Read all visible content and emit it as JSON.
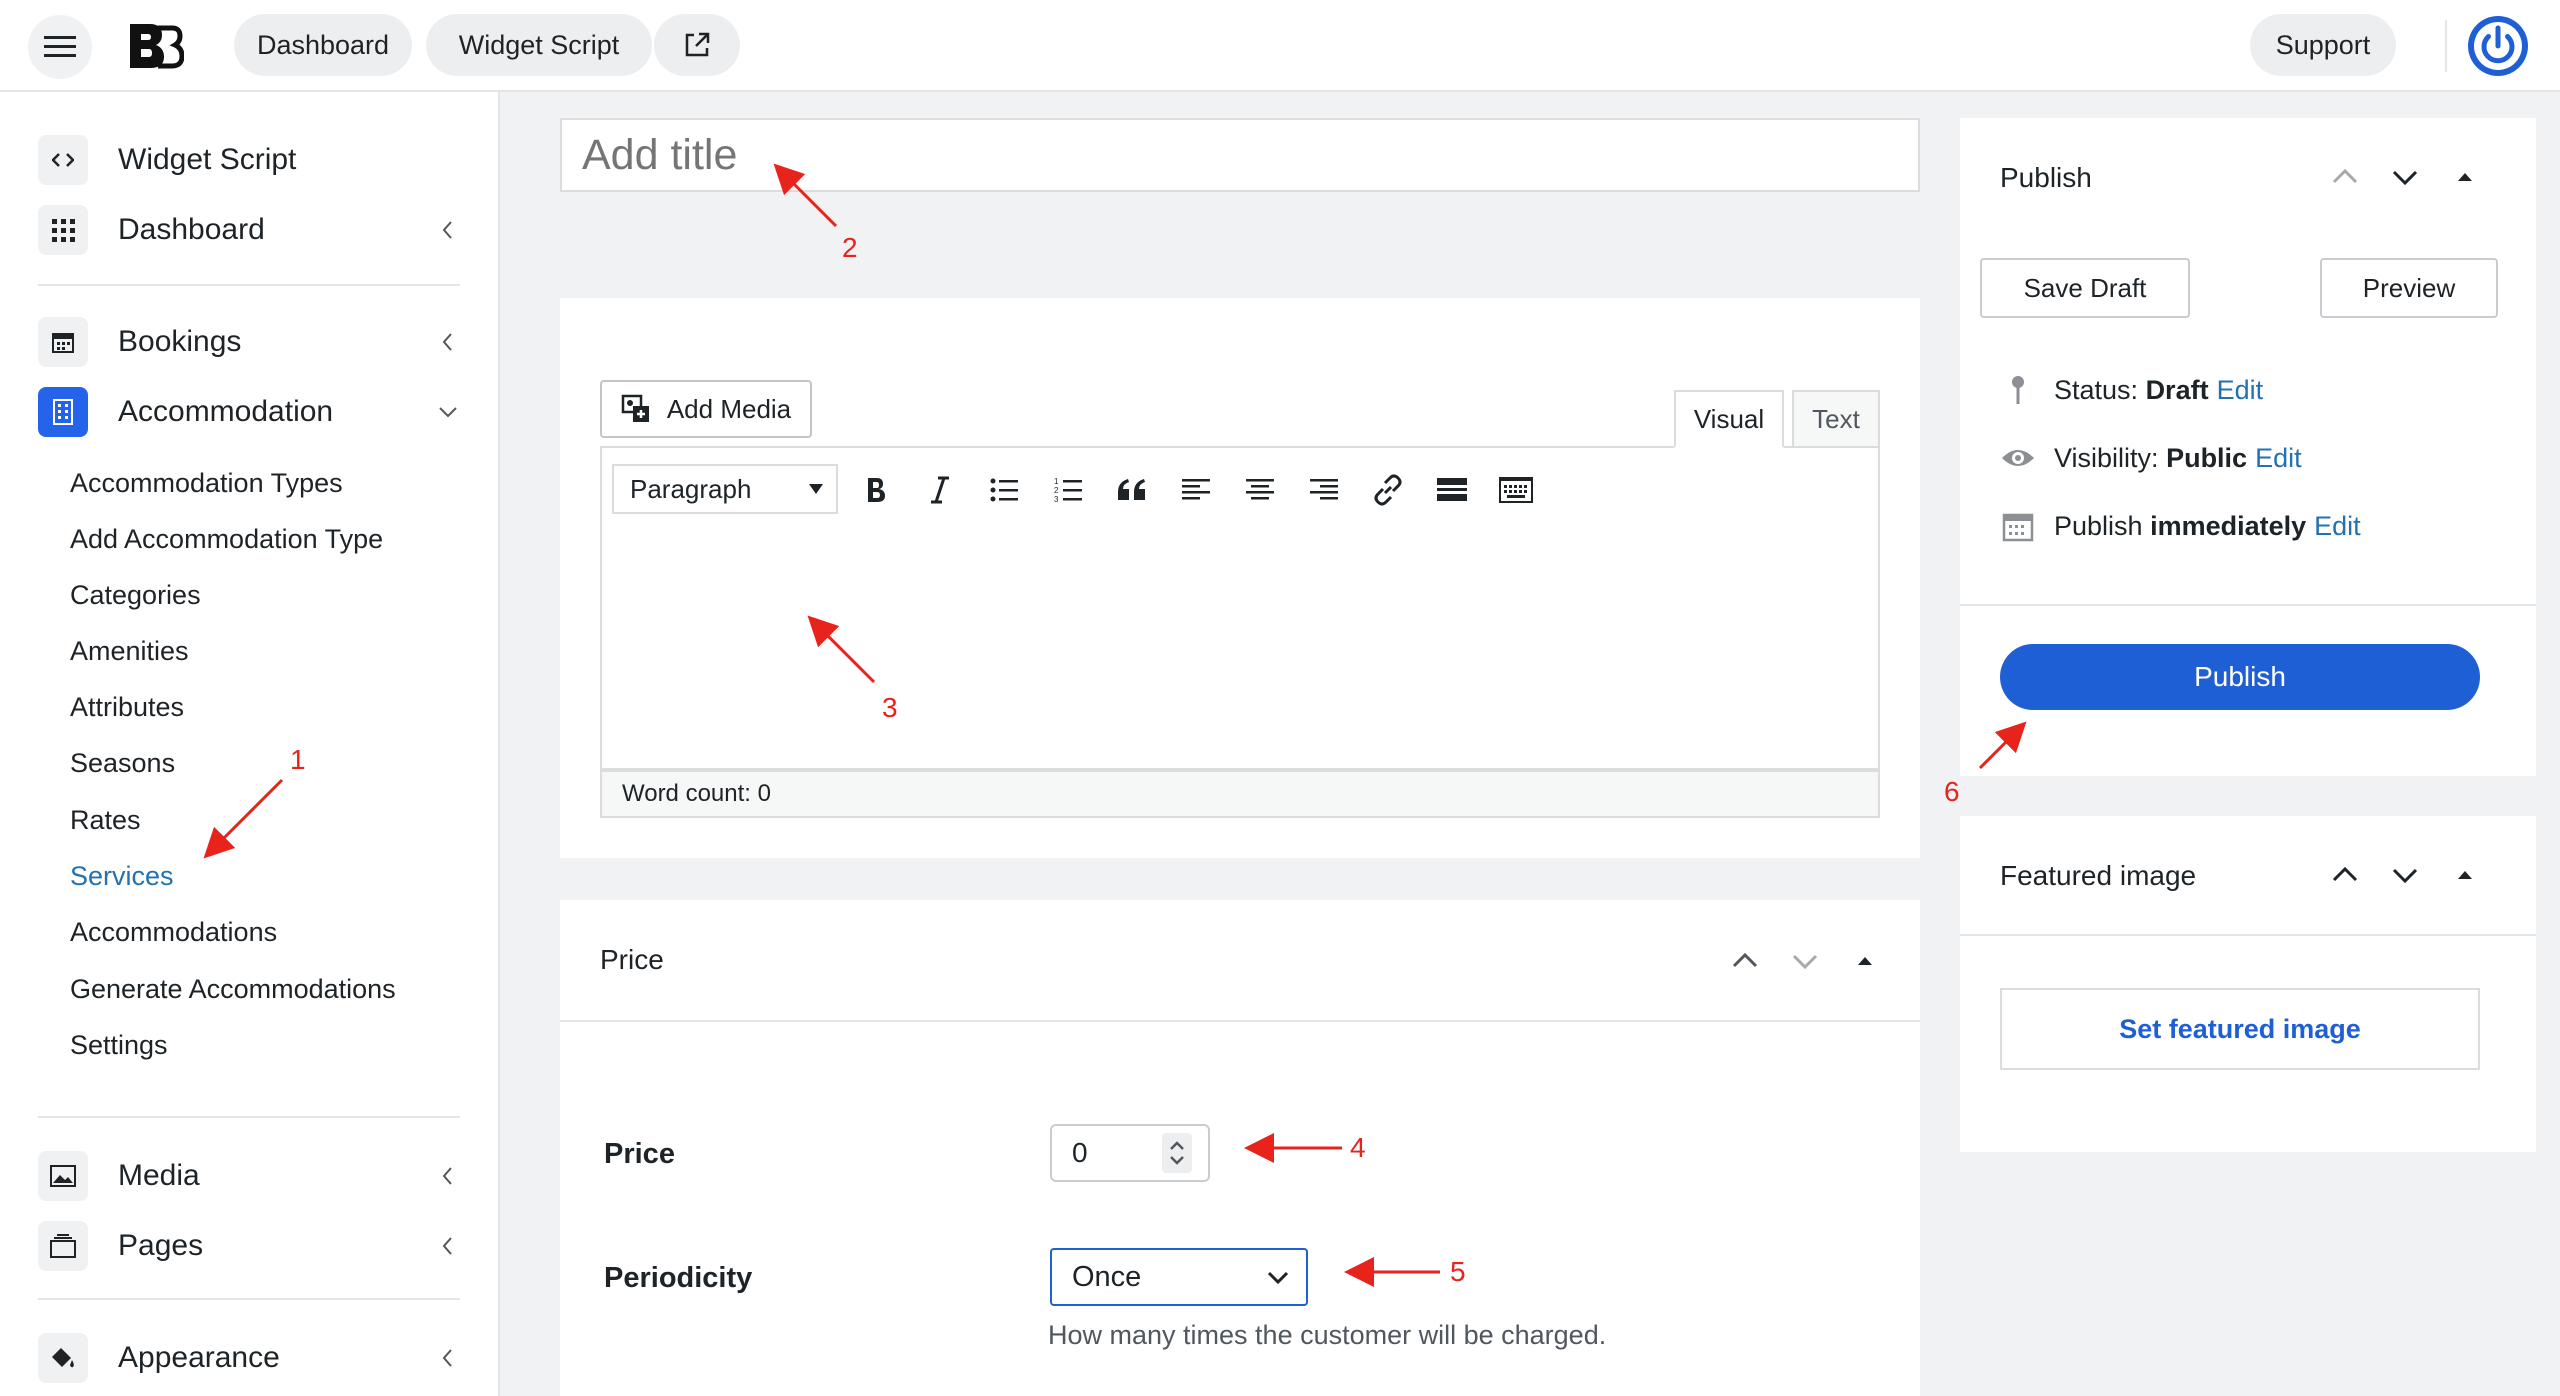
{
  "topbar": {
    "dashboard": "Dashboard",
    "widget_script": "Widget Script",
    "support": "Support"
  },
  "sidebar": {
    "items": [
      {
        "label": "Widget Script",
        "icon": "code-icon"
      },
      {
        "label": "Dashboard",
        "icon": "grid-icon"
      },
      {
        "label": "Bookings",
        "icon": "calendar-icon"
      },
      {
        "label": "Accommodation",
        "icon": "building-icon"
      },
      {
        "label": "Media",
        "icon": "image-icon"
      },
      {
        "label": "Pages",
        "icon": "pages-icon"
      },
      {
        "label": "Appearance",
        "icon": "paint-bucket-icon"
      }
    ],
    "submenu": [
      "Accommodation Types",
      "Add Accommodation Type",
      "Categories",
      "Amenities",
      "Attributes",
      "Seasons",
      "Rates",
      "Services",
      "Accommodations",
      "Generate Accommodations",
      "Settings"
    ],
    "active_submenu": "Services"
  },
  "editor": {
    "title_placeholder": "Add title",
    "add_media": "Add Media",
    "tab_visual": "Visual",
    "tab_text": "Text",
    "format_select": "Paragraph",
    "word_count": "Word count: 0"
  },
  "price_panel": {
    "title": "Price",
    "price_label": "Price",
    "price_value": "0",
    "periodicity_label": "Periodicity",
    "periodicity_value": "Once",
    "periodicity_help": "How many times the customer will be charged."
  },
  "publish_panel": {
    "title": "Publish",
    "save_draft": "Save Draft",
    "preview": "Preview",
    "status_label": "Status:",
    "status_value": "Draft",
    "visibility_label": "Visibility:",
    "visibility_value": "Public",
    "publish_label": "Publish",
    "publish_value": "immediately",
    "edit": "Edit",
    "publish_button": "Publish"
  },
  "featured_panel": {
    "title": "Featured image",
    "set_link": "Set featured image"
  },
  "annotations": [
    "1",
    "2",
    "3",
    "4",
    "5",
    "6"
  ],
  "colors": {
    "accent": "#2563eb",
    "link": "#2271b1",
    "annotation": "#e8231c"
  }
}
